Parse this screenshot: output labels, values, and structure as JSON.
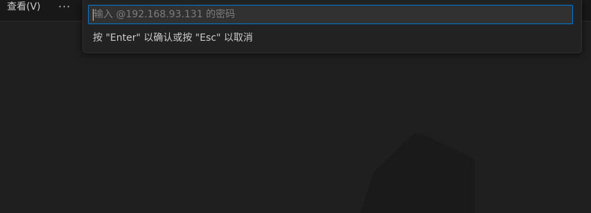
{
  "menubar": {
    "view_label": "查看(V)",
    "more_label": "···"
  },
  "quick_input": {
    "value": "",
    "placeholder": "输入 @192.168.93.131 的密码",
    "message": "按 \"Enter\" 以确认或按 \"Esc\" 以取消"
  },
  "colors": {
    "accent": "#0078d4",
    "background": "#1f1f1f",
    "panel": "#222222"
  }
}
